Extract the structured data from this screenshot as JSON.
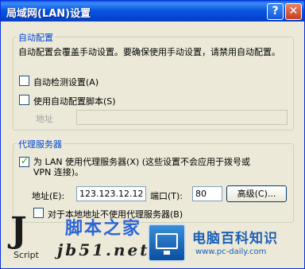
{
  "window": {
    "title": "局域网(LAN)设置",
    "help_glyph": "?",
    "close_glyph": "✕"
  },
  "auto_config": {
    "legend": "自动配置",
    "description": "自动配置会覆盖手动设置。要确保使用手动设置，请禁用自动配置。",
    "auto_detect_label": "自动检测设置(A)",
    "auto_detect_checked": false,
    "use_script_label": "使用自动配置脚本(S)",
    "use_script_checked": false,
    "address_label": "地址",
    "address_value": ""
  },
  "proxy": {
    "legend": "代理服务器",
    "use_proxy_label": "为 LAN 使用代理服务器(X) (这些设置不会应用于拨号或",
    "use_proxy_label_line2": "VPN 连接)。",
    "use_proxy_checked": true,
    "address_label": "地址(E):",
    "address_value": "123.123.12.12",
    "port_label": "端口(T):",
    "port_value": "80",
    "advanced_button": "高级(C)...",
    "bypass_label": "对于本地地址不使用代理服务器(B)",
    "bypass_checked": false
  },
  "watermarks": {
    "left_logo_letter": "J",
    "left_logo_text": "Script",
    "left_site_name": "脚本之家",
    "left_site_url": "jb51.net",
    "right_site_name": "电脑百科知识",
    "right_site_url": "www.pc-daily.com"
  }
}
